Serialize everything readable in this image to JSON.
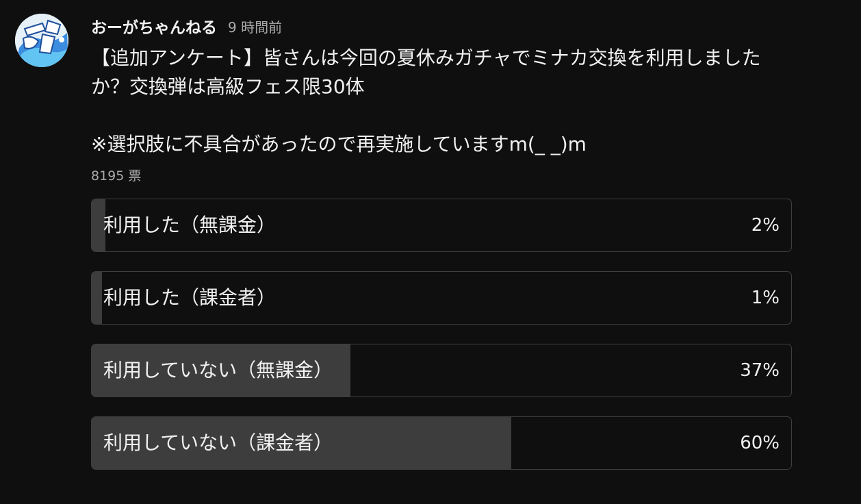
{
  "post": {
    "author": "おーがちゃんねる",
    "time": "9 時間前",
    "text": "【追加アンケート】皆さんは今回の夏休みガチャでミナカ交換を利用しましたか？交換弾は高級フェス限30体\n\n※選択肢に不具合があったので再実施していますm(_ _)m",
    "votes": "8195 票",
    "avatar_icon": "channel-logo-icon"
  },
  "poll": {
    "options": [
      {
        "label": "利用した（無課金）",
        "percent_text": "2%",
        "percent": 2
      },
      {
        "label": "利用した（課金者）",
        "percent_text": "1%",
        "percent": 1
      },
      {
        "label": "利用していない（無課金）",
        "percent_text": "37%",
        "percent": 37
      },
      {
        "label": "利用していない（課金者）",
        "percent_text": "60%",
        "percent": 60
      }
    ]
  },
  "colors": {
    "background": "#0f0f0f",
    "text": "#f1f1f1",
    "secondary_text": "#aaaaaa",
    "option_border": "#3f3f3f",
    "fill": "#3d3d3d"
  }
}
